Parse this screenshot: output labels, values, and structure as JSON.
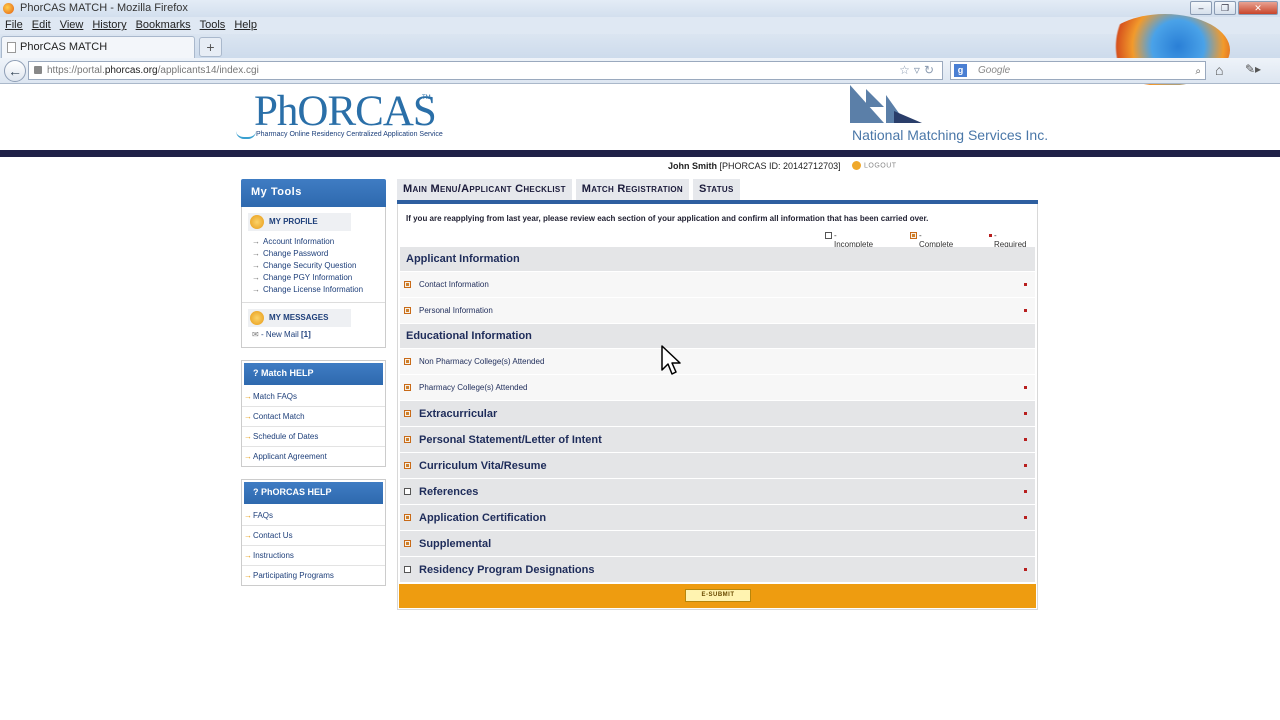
{
  "browser": {
    "window_title": "PhorCAS MATCH - Mozilla Firefox",
    "menu": [
      "File",
      "Edit",
      "View",
      "History",
      "Bookmarks",
      "Tools",
      "Help"
    ],
    "tab_title": "PhorCAS MATCH",
    "url_prefix": "https://portal.",
    "url_domain": "phorcas.org",
    "url_path": "/applicants14/index.cgi",
    "search_placeholder": "Google"
  },
  "header": {
    "phorcas_logo_text": "PhORCAS",
    "phorcas_tagline": "Pharmacy Online Residency Centralized Application Service",
    "nms_logo_text": "National Matching Services Inc."
  },
  "user": {
    "name": "John Smith",
    "id_text": "[PHORCAS ID: 20142712703]",
    "logout_label": "LOGOUT"
  },
  "sidebar": {
    "title": "My Tools",
    "profile_title": "MY PROFILE",
    "profile_links": [
      "Account Information",
      "Change Password",
      "Change Security Question",
      "Change PGY Information",
      "Change License Information"
    ],
    "messages_title": "MY MESSAGES",
    "new_mail_label": "- New Mail",
    "new_mail_count": "[1]",
    "match_help_title": "? Match HELP",
    "match_help_links": [
      "Match FAQs",
      "Contact Match",
      "Schedule of Dates",
      "Applicant Agreement"
    ],
    "phorcas_help_title": "? PhORCAS HELP",
    "phorcas_help_links": [
      "FAQs",
      "Contact Us",
      "Instructions",
      "Participating Programs"
    ]
  },
  "main": {
    "tabs": [
      "Main Menu/Applicant Checklist",
      "Match Registration",
      "Status"
    ],
    "notice": "If you are reapplying from last year, please review each section of your application and confirm all information that has been carried over.",
    "legend": {
      "incomplete": "- Incomplete",
      "complete": "- Complete",
      "required": "- Required"
    },
    "sections": {
      "applicant_info": "Applicant Information",
      "contact_info": "Contact Information",
      "personal_info": "Personal Information",
      "educational_info": "Educational Information",
      "non_pharmacy": "Non Pharmacy College(s) Attended",
      "pharmacy": "Pharmacy College(s) Attended",
      "extracurricular": "Extracurricular",
      "personal_statement": "Personal Statement/Letter of Intent",
      "cv": "Curriculum Vita/Resume",
      "references": "References",
      "certification": "Application Certification",
      "supplemental": "Supplemental",
      "designations": "Residency Program Designations"
    },
    "submit_label": "E-SUBMIT"
  },
  "colors": {
    "accent_blue": "#2e69ae",
    "dark_band": "#1f2148",
    "submit_orange": "#ee9c10",
    "required_red": "#b81f1f"
  }
}
